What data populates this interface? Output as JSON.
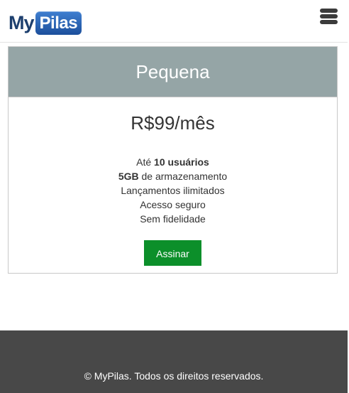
{
  "header": {
    "logo_prefix": "My",
    "logo_badge": "Pilas",
    "menu_icon": "hamburger-menu-icon"
  },
  "plan": {
    "name": "Pequena",
    "price": "R$99/mês",
    "features": [
      {
        "prefix": "Até ",
        "bold": "10 usuários",
        "suffix": ""
      },
      {
        "prefix": "",
        "bold": "5GB",
        "suffix": " de armazenamento"
      },
      {
        "prefix": "",
        "bold": "",
        "suffix": "Lançamentos ilimitados"
      },
      {
        "prefix": "",
        "bold": "",
        "suffix": "Acesso seguro"
      },
      {
        "prefix": "",
        "bold": "",
        "suffix": "Sem fidelidade"
      }
    ],
    "button_label": "Assinar"
  },
  "footer": {
    "text": "© MyPilas. Todos os direitos reservados."
  },
  "colors": {
    "plan_header_bg": "#95a5a6",
    "button_bg": "#0c8f2a",
    "footer_bg": "#484848",
    "logo_blue": "#1d3f6e"
  }
}
